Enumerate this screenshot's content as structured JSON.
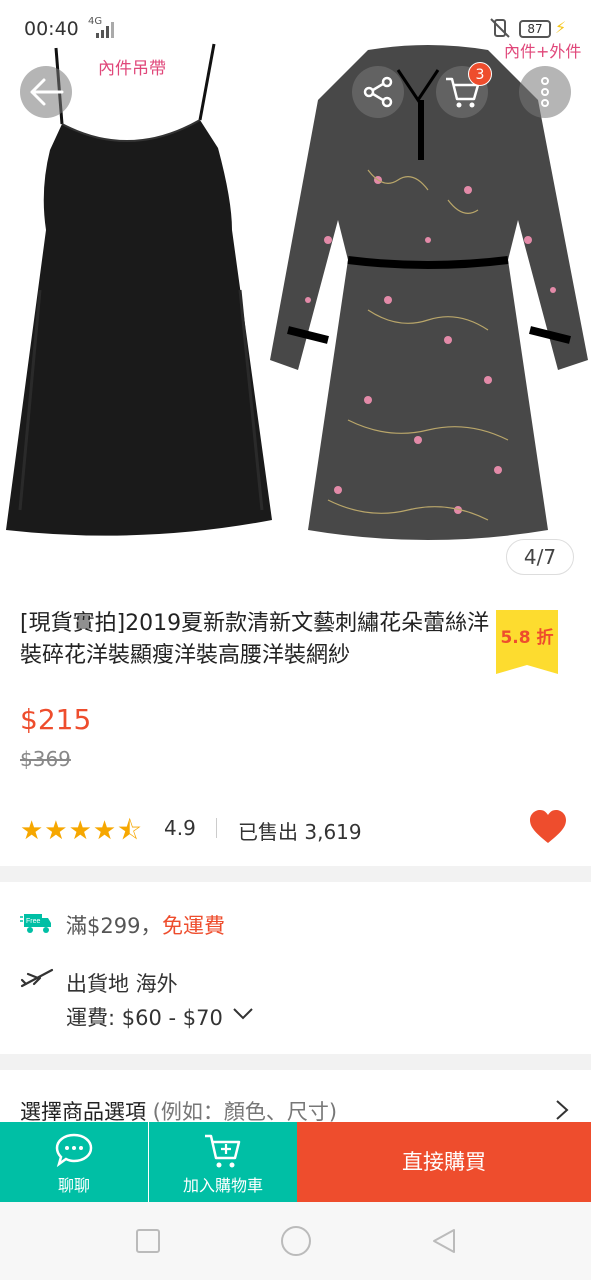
{
  "status_bar": {
    "time": "00:40",
    "network": "4G",
    "battery": "87"
  },
  "gallery": {
    "label_inner": "內件吊帶",
    "label_both": "內件+外件",
    "counter": "4/7",
    "cart_badge": "3"
  },
  "product": {
    "title": "[現貨實拍]2019夏新款清新文藝刺繡花朵蕾絲洋裝碎花洋裝顯瘦洋裝高腰洋裝網紗",
    "discount": "5.8 折",
    "price": "$215",
    "original_price": "$369",
    "stars": "★★★★⯪",
    "rating": "4.9",
    "sold": "已售出 3,619"
  },
  "shipping": {
    "free_icon_text": "Free",
    "threshold": "滿$299，",
    "free_label": "免運費",
    "origin": "出貨地 海外",
    "fee": "運費: $60 - $70"
  },
  "options": {
    "label": "選擇商品選項",
    "hint": " (例如：顏色、尺寸)"
  },
  "actions": {
    "chat": "聊聊",
    "add_to_cart": "加入購物車",
    "buy_now": "直接購買"
  },
  "colors": {
    "brand": "#ee4d2d",
    "teal": "#00bfa5",
    "star": "#f6a700"
  }
}
